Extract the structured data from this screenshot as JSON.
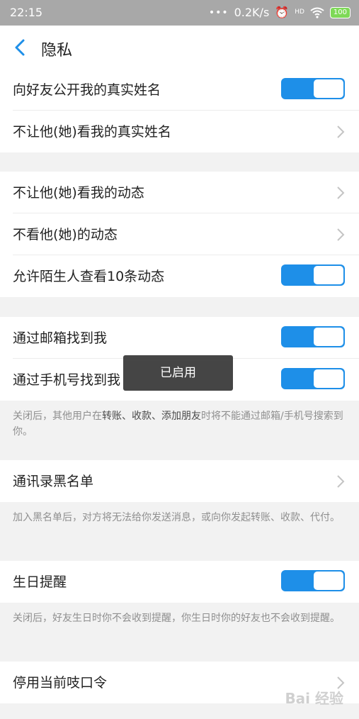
{
  "status": {
    "time": "22:15",
    "dots": "•••",
    "speed": "0.2K/s",
    "battery": "100"
  },
  "header": {
    "title": "隐私"
  },
  "rows": {
    "r1": "向好友公开我的真实姓名",
    "r2": "不让他(她)看我的真实姓名",
    "r3": "不让他(她)看我的动态",
    "r4": "不看他(她)的动态",
    "r5": "允许陌生人查看10条动态",
    "r6": "通过邮箱找到我",
    "r7": "通过手机号找到我",
    "r8": "通讯录黑名单",
    "r9": "生日提醒",
    "r10": "停用当前吱口令"
  },
  "toggles": {
    "r1": true,
    "r5": true,
    "r6": true,
    "r7": true,
    "r9": true
  },
  "notes": {
    "find_pre": "关闭后，其他用户在",
    "find_strong": "转账、收款、添加朋友",
    "find_post": "时将不能通过邮箱/手机号搜索到你。",
    "blacklist": "加入黑名单后，对方将无法给你发送消息，或向你发起转账、收款、代付。",
    "birthday": "关闭后，好友生日时你不会收到提醒，你生日时你的好友也不会收到提醒。"
  },
  "toast": "已启用",
  "watermark": "Bai 经验",
  "colors": {
    "accent": "#1e8fe8",
    "statusbar": "#a8a8a8",
    "background": "#f2f2f2"
  }
}
